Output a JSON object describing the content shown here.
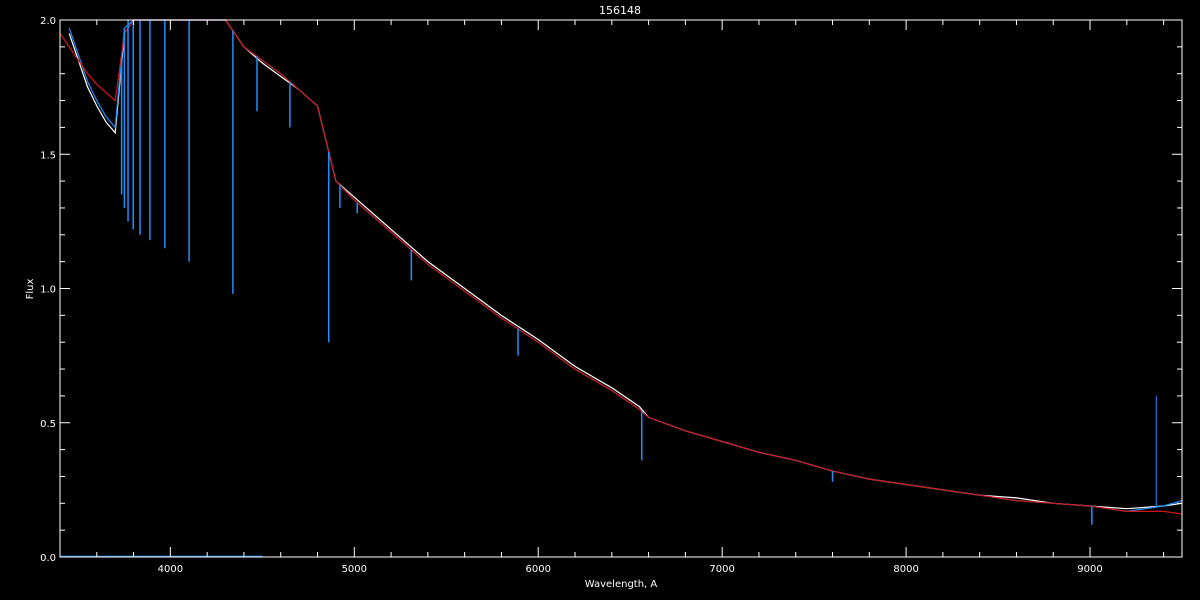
{
  "chart_data": {
    "type": "line",
    "title": "156148",
    "xlabel": "Wavelength, A",
    "ylabel": "Flux",
    "xlim": [
      3400,
      9500
    ],
    "ylim": [
      0.0,
      2.0
    ],
    "x_ticks": [
      4000,
      5000,
      6000,
      7000,
      8000,
      9000
    ],
    "y_ticks": [
      0.0,
      0.5,
      1.0,
      1.5,
      2.0
    ],
    "x_tick_labels": [
      "4000",
      "5000",
      "6000",
      "7000",
      "8000",
      "9000"
    ],
    "y_tick_labels": [
      "0.0",
      "0.5",
      "1.0",
      "1.5",
      "2.0"
    ],
    "grid": false,
    "colors": {
      "background": "#000000",
      "axes": "#ffffff",
      "white_spectrum": "#ffffff",
      "blue_spectrum": "#1e8fff",
      "red_model": "#d11414"
    },
    "series": [
      {
        "color": "#ffffff",
        "x": [
          3450,
          3500,
          3550,
          3600,
          3650,
          3700,
          3750,
          3800,
          3900,
          4000,
          4100,
          4200,
          4300,
          4400,
          4500,
          4600,
          4700,
          4800,
          4900,
          5000,
          5200,
          5400,
          5600,
          5800,
          6000,
          6200,
          6400,
          6550,
          6600,
          6800,
          7000,
          7200,
          7400,
          7600,
          7800,
          8000,
          8200,
          8400,
          8600,
          8800,
          9000,
          9200,
          9400,
          9500
        ],
        "y": [
          1.95,
          1.85,
          1.75,
          1.68,
          1.62,
          1.58,
          1.95,
          2.1,
          2.2,
          2.15,
          2.1,
          2.05,
          2.0,
          1.9,
          1.84,
          1.79,
          1.74,
          1.68,
          1.4,
          1.34,
          1.22,
          1.1,
          1.0,
          0.9,
          0.81,
          0.71,
          0.63,
          0.56,
          0.52,
          0.47,
          0.43,
          0.39,
          0.36,
          0.32,
          0.29,
          0.27,
          0.25,
          0.23,
          0.22,
          0.2,
          0.19,
          0.18,
          0.19,
          0.2
        ]
      },
      {
        "color": "#1e8fff",
        "x": [
          3450,
          3500,
          3550,
          3600,
          3650,
          3700,
          3750,
          3800,
          3900,
          4000,
          4100,
          4200,
          4300,
          4400,
          4500,
          4600,
          4700,
          4800,
          4900,
          5000,
          5200,
          5400,
          5600,
          5800,
          6000,
          6200,
          6400,
          6550,
          6600,
          6800,
          7000,
          7200,
          7400,
          7600,
          7800,
          8000,
          8200,
          8400,
          8600,
          8800,
          9000,
          9200,
          9400,
          9500
        ],
        "y": [
          1.97,
          1.87,
          1.77,
          1.7,
          1.64,
          1.6,
          1.97,
          2.1,
          2.2,
          2.15,
          2.1,
          2.05,
          2.0,
          1.9,
          1.85,
          1.8,
          1.74,
          1.68,
          1.4,
          1.33,
          1.21,
          1.09,
          0.99,
          0.89,
          0.8,
          0.7,
          0.62,
          0.55,
          0.52,
          0.47,
          0.43,
          0.39,
          0.36,
          0.32,
          0.29,
          0.27,
          0.25,
          0.23,
          0.21,
          0.2,
          0.19,
          0.17,
          0.19,
          0.21
        ]
      },
      {
        "color": "#d11414",
        "x": [
          3400,
          3450,
          3500,
          3550,
          3600,
          3650,
          3700,
          3750,
          3800,
          3900,
          4000,
          4100,
          4200,
          4300,
          4400,
          4500,
          4600,
          4700,
          4800,
          4900,
          5000,
          5200,
          5400,
          5600,
          5800,
          6000,
          6200,
          6400,
          6550,
          6600,
          6800,
          7000,
          7200,
          7400,
          7600,
          7800,
          8000,
          8200,
          8400,
          8600,
          8800,
          9000,
          9200,
          9400,
          9500
        ],
        "y": [
          1.95,
          1.9,
          1.85,
          1.8,
          1.76,
          1.73,
          1.7,
          1.95,
          2.1,
          2.2,
          2.15,
          2.1,
          2.05,
          2.0,
          1.9,
          1.85,
          1.8,
          1.74,
          1.68,
          1.4,
          1.33,
          1.21,
          1.09,
          0.99,
          0.89,
          0.8,
          0.7,
          0.62,
          0.55,
          0.52,
          0.47,
          0.43,
          0.39,
          0.36,
          0.32,
          0.29,
          0.27,
          0.25,
          0.23,
          0.21,
          0.2,
          0.19,
          0.17,
          0.17,
          0.16
        ]
      }
    ],
    "absorption_lines": [
      {
        "x": 3735,
        "depth_to": 1.35
      },
      {
        "x": 3750,
        "depth_to": 1.3
      },
      {
        "x": 3770,
        "depth_to": 1.25
      },
      {
        "x": 3798,
        "depth_to": 1.22
      },
      {
        "x": 3835,
        "depth_to": 1.2
      },
      {
        "x": 3889,
        "depth_to": 1.18
      },
      {
        "x": 3970,
        "depth_to": 1.15
      },
      {
        "x": 4102,
        "depth_to": 1.1
      },
      {
        "x": 4340,
        "depth_to": 0.98
      },
      {
        "x": 4471,
        "depth_to": 1.66
      },
      {
        "x": 4650,
        "depth_to": 1.6
      },
      {
        "x": 4861,
        "depth_to": 0.8
      },
      {
        "x": 4922,
        "depth_to": 1.3
      },
      {
        "x": 5016,
        "depth_to": 1.28
      },
      {
        "x": 5310,
        "depth_to": 1.03
      },
      {
        "x": 5890,
        "depth_to": 0.75
      },
      {
        "x": 6563,
        "depth_to": 0.36
      },
      {
        "x": 7600,
        "depth_to": 0.28
      },
      {
        "x": 9010,
        "depth_to": 0.12
      }
    ],
    "spike": {
      "x": 9360,
      "y_to": 0.6
    }
  }
}
